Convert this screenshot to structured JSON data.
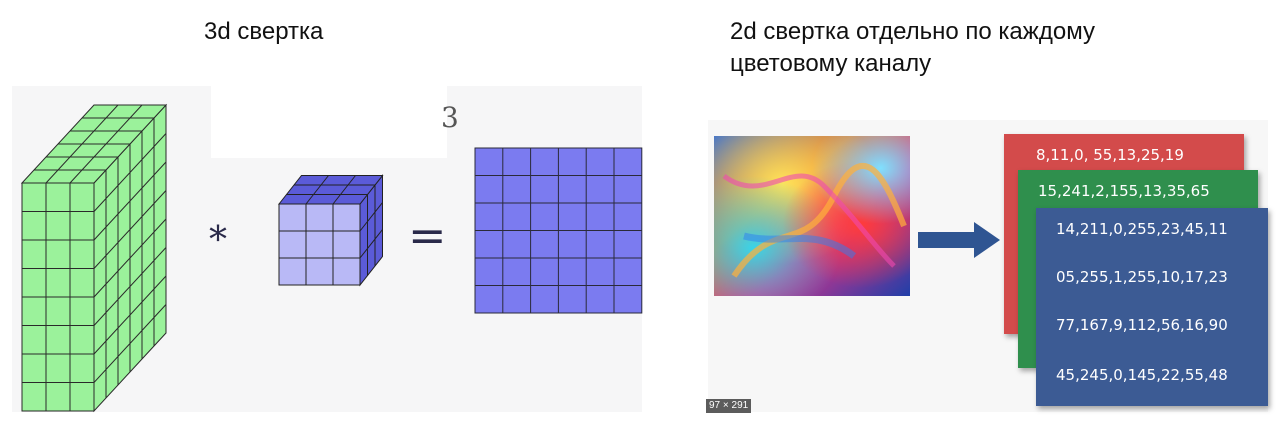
{
  "left": {
    "title": "3d свертка",
    "multiply_symbol": "*",
    "equals_symbol": "=",
    "stray_glyph": "3",
    "input_volume_color": "#9bf29b",
    "kernel_color": "#b9b9f6",
    "output_color": "#7b7bf0"
  },
  "right": {
    "title_line1": "2d свертка отдельно по каждому",
    "title_line2": "цветовому каналу",
    "arrow_color": "#2f5592",
    "cards": {
      "red": {
        "color": "#d34b4b",
        "line1": "8,11,0, 55,13,25,19"
      },
      "green": {
        "color": "#2f8f4d",
        "line1": "15,241,2,155,13,35,65"
      },
      "blue": {
        "color": "#3c5b94",
        "lines": [
          "14,211,0,255,23,45,11",
          "05,255,1,255,10,17,23",
          "77,167,9,112,56,16,90",
          "45,245,0,145,22,55,48"
        ]
      }
    },
    "image_size_badge": "97 × 291"
  }
}
